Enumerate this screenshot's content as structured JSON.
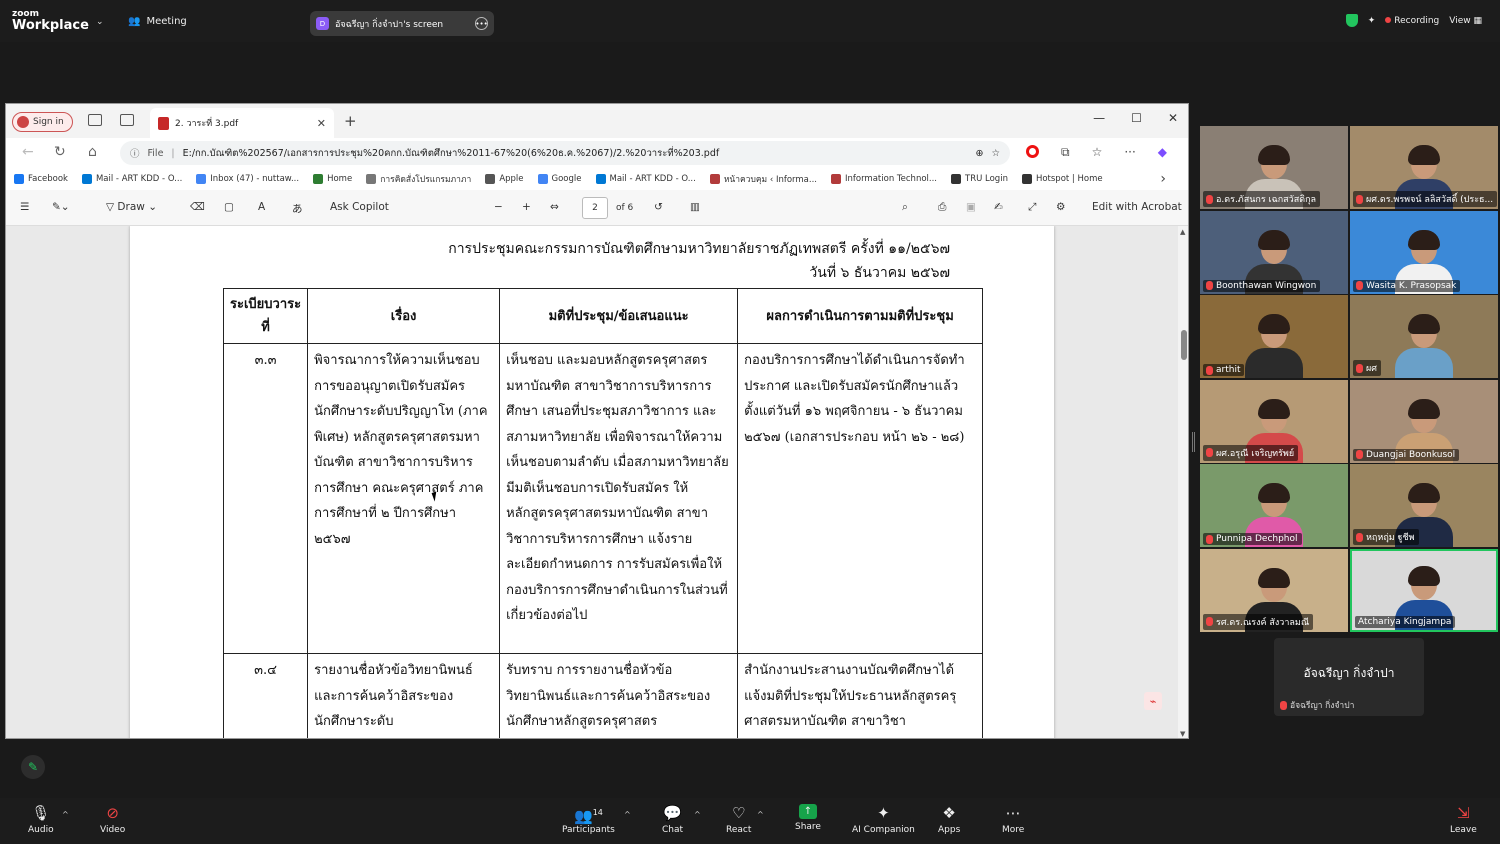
{
  "zoom": {
    "logo_top": "zoom",
    "logo_bottom": "Workplace",
    "meeting_label": "Meeting",
    "share_avatar": "D",
    "share_label": "อัจฉรีญา  กิ่งจำปา's screen",
    "recording_label": "Recording",
    "view_label": "View"
  },
  "browser": {
    "signin_label": "Sign in",
    "tab_title": "2. วาระที่ 3.pdf",
    "url_prefix": "File",
    "url": "E:/กก.บัณฑิต%202567/เอกสารการประชุม%20คกก.บัณฑิตศึกษา%2011-67%20(6%20ธ.ค.%2067)/2.%20วาระที่%203.pdf",
    "favorites": [
      {
        "label": "Facebook",
        "color": "#1877f2"
      },
      {
        "label": "Mail - ART KDD - O...",
        "color": "#0078d4"
      },
      {
        "label": "Inbox (47) - nuttaw...",
        "color": "#4285f4"
      },
      {
        "label": "Home",
        "color": "#2e7d32"
      },
      {
        "label": "การคิดสั่งโปรแกรมภาภา",
        "color": "#777777"
      },
      {
        "label": "Apple",
        "color": "#555555"
      },
      {
        "label": "Google",
        "color": "#4285f4"
      },
      {
        "label": "Mail - ART KDD - O...",
        "color": "#0078d4"
      },
      {
        "label": "หน้าควบคุม ‹ Informa...",
        "color": "#b23b3b"
      },
      {
        "label": "Information Technol...",
        "color": "#b23b3b"
      },
      {
        "label": "TRU Login",
        "color": "#333333"
      },
      {
        "label": "Hotspot | Home",
        "color": "#333333"
      }
    ]
  },
  "pdf_toolbar": {
    "draw_label": "Draw",
    "copilot_label": "Ask Copilot",
    "page_current": "2",
    "page_total": "of 6",
    "acrobat_label": "Edit with Acrobat"
  },
  "document": {
    "heading_line1": "การประชุมคณะกรรมการบัณฑิตศึกษามหาวิทยาลัยราชภัฏเทพสตรี ครั้งที่ ๑๑/๒๕๖๗",
    "heading_line2": "วันที่ ๖ ธันวาคม ๒๕๖๗",
    "columns": [
      "ระเบียบวาระที่",
      "เรื่อง",
      "มติที่ประชุม/ข้อเสนอแนะ",
      "ผลการดำเนินการตามมติที่ประชุม"
    ],
    "rows": [
      {
        "agenda": "๓.๓",
        "topic": "พิจารณาการให้ความเห็นชอบการขออนุญาตเปิดรับสมัครนักศึกษาระดับปริญญาโท (ภาคพิเศษ) หลักสูตรครุศาสตรมหาบัณฑิต สาขาวิชาการบริหารการศึกษา คณะครุศาสตร์ ภาคการศึกษาที่ ๒ ปีการศึกษา ๒๕๖๗",
        "resolution": "เห็นชอบ และมอบหลักสูตรครุศาสตรมหาบัณฑิต สาขาวิชาการบริหารการศึกษา เสนอที่ประชุมสภาวิชาการ และสภามหาวิทยาลัย เพื่อพิจารณาให้ความเห็นชอบตามลำดับ เมื่อสภามหาวิทยาลัยมีมติเห็นชอบการเปิดรับสมัคร ให้หลักสูตรครุศาสตรมหาบัณฑิต สาขาวิชาการบริหารการศึกษา แจ้งรายละเอียดกำหนดการ การรับสมัครเพื่อให้กองบริการการศึกษาดำเนินการในส่วนที่เกี่ยวข้องต่อไป",
        "result": "กองบริการการศึกษาได้ดำเนินการจัดทำประกาศ และเปิดรับสมัครนักศึกษาแล้วตั้งแต่วันที่ ๑๖ พฤศจิกายน - ๖ ธันวาคม ๒๕๖๗ (เอกสารประกอบ หน้า ๒๖ - ๒๘)"
      },
      {
        "agenda": "๓.๔",
        "topic": "รายงานชื่อหัวข้อวิทยานิพนธ์และการค้นคว้าอิสระของนักศึกษาระดับ",
        "resolution": "รับทราบ การรายงานชื่อหัวข้อวิทยานิพนธ์และการค้นคว้าอิสระของนักศึกษาหลักสูตรครุศาสตร",
        "result": "สำนักงานประสานงานบัณฑิตศึกษาได้แจ้งมติที่ประชุมให้ประธานหลักสูตรครุศาสตรมหาบัณฑิต สาขาวิชา"
      }
    ]
  },
  "participants": [
    {
      "name": "อ.ดร.ภัสนกร เฉกสวัสดิกุล",
      "bg": "#8a7f74",
      "shirt": "#c9c2b8"
    },
    {
      "name": "ผศ.ดร.พรพจน์  ลลิสวัสดิ์ (ประธ...",
      "bg": "#a38b6a",
      "shirt": "#2f3f66"
    },
    {
      "name": "Boonthawan Wingwon",
      "bg": "#4d5f7a",
      "shirt": "#333333"
    },
    {
      "name": "Wasita K. Prasopsak",
      "bg": "#3b89d8",
      "shirt": "#f1f1f1"
    },
    {
      "name": "arthit",
      "bg": "#8a6a3a",
      "shirt": "#2b2b2b"
    },
    {
      "name": "ผศ",
      "bg": "#8e7a58",
      "shirt": "#6aa0c8"
    },
    {
      "name": "ผศ.อรุณี เจริญทรัพย์",
      "bg": "#b69a75",
      "shirt": "#d44a4a"
    },
    {
      "name": "Duangjai Boonkusol",
      "bg": "#a88f78",
      "shirt": "#caa074"
    },
    {
      "name": "Punnipa Dechphol",
      "bg": "#7a9a6a",
      "shirt": "#e05aa8"
    },
    {
      "name": "หฤหฤุ่ม ฐูชีพ",
      "bg": "#9a8560",
      "shirt": "#1f2a44"
    },
    {
      "name": "รศ.ดร.ณรงค์ สังวาลมณี",
      "bg": "#c8b08a",
      "shirt": "#222222"
    },
    {
      "name": "Atchariya Kingjampa",
      "bg": "#d9d9d9",
      "shirt": "#1f4f9a"
    }
  ],
  "self_tile": {
    "big_name": "อัจฉรีญา  กิ่งจำปา",
    "small_name": "อัจฉรีญา  กิ่งจำปา"
  },
  "bottom": {
    "audio": "Audio",
    "video": "Video",
    "participants": "Participants",
    "participant_count": "14",
    "chat": "Chat",
    "react": "React",
    "share": "Share",
    "ai": "AI Companion",
    "apps": "Apps",
    "more": "More",
    "leave": "Leave"
  }
}
